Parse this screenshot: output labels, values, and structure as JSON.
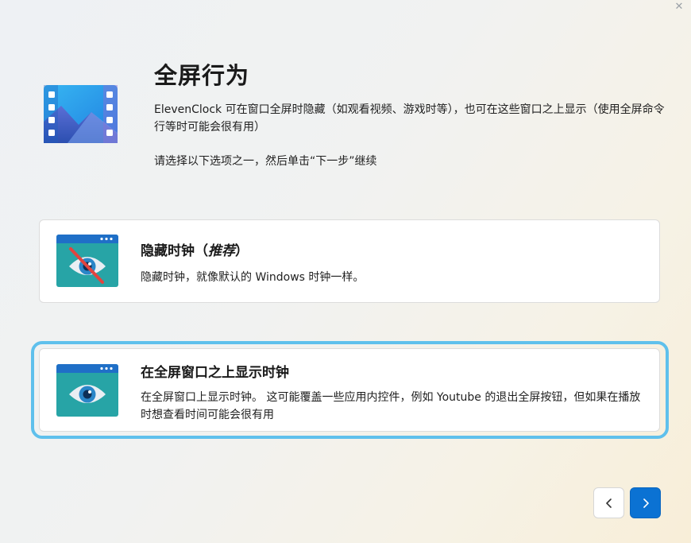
{
  "window": {
    "close_glyph": "✕"
  },
  "header": {
    "icon": "video-frame-icon",
    "title": "全屏行为",
    "description": "ElevenClock 可在窗口全屏时隐藏（如观看视频、游戏时等），也可在这些窗口之上显示（使用全屏命令行等时可能会很有用）",
    "instruction": "请选择以下选项之一，然后单击“下一步”继续"
  },
  "options": [
    {
      "icon": "eye-crossed-icon",
      "title": "隐藏时钟（",
      "title_emphasis": "推荐",
      "title_end": "）",
      "description": "隐藏时钟，就像默认的 Windows 时钟一样。",
      "selected": false
    },
    {
      "icon": "eye-icon",
      "title": "在全屏窗口之上显示时钟",
      "description": "在全屏窗口上显示时钟。 这可能覆盖一些应用内控件，例如 Youtube 的退出全屏按钮，但如果在播放时想查看时间可能会很有用",
      "selected": true
    }
  ],
  "navigation": {
    "back_icon": "chevron-left-icon",
    "next_icon": "chevron-right-icon"
  },
  "colors": {
    "accent": "#0b72d3",
    "selection_ring": "#5fc0ec",
    "icon_teal": "#27a4a6",
    "icon_blue": "#1f6fc7"
  }
}
